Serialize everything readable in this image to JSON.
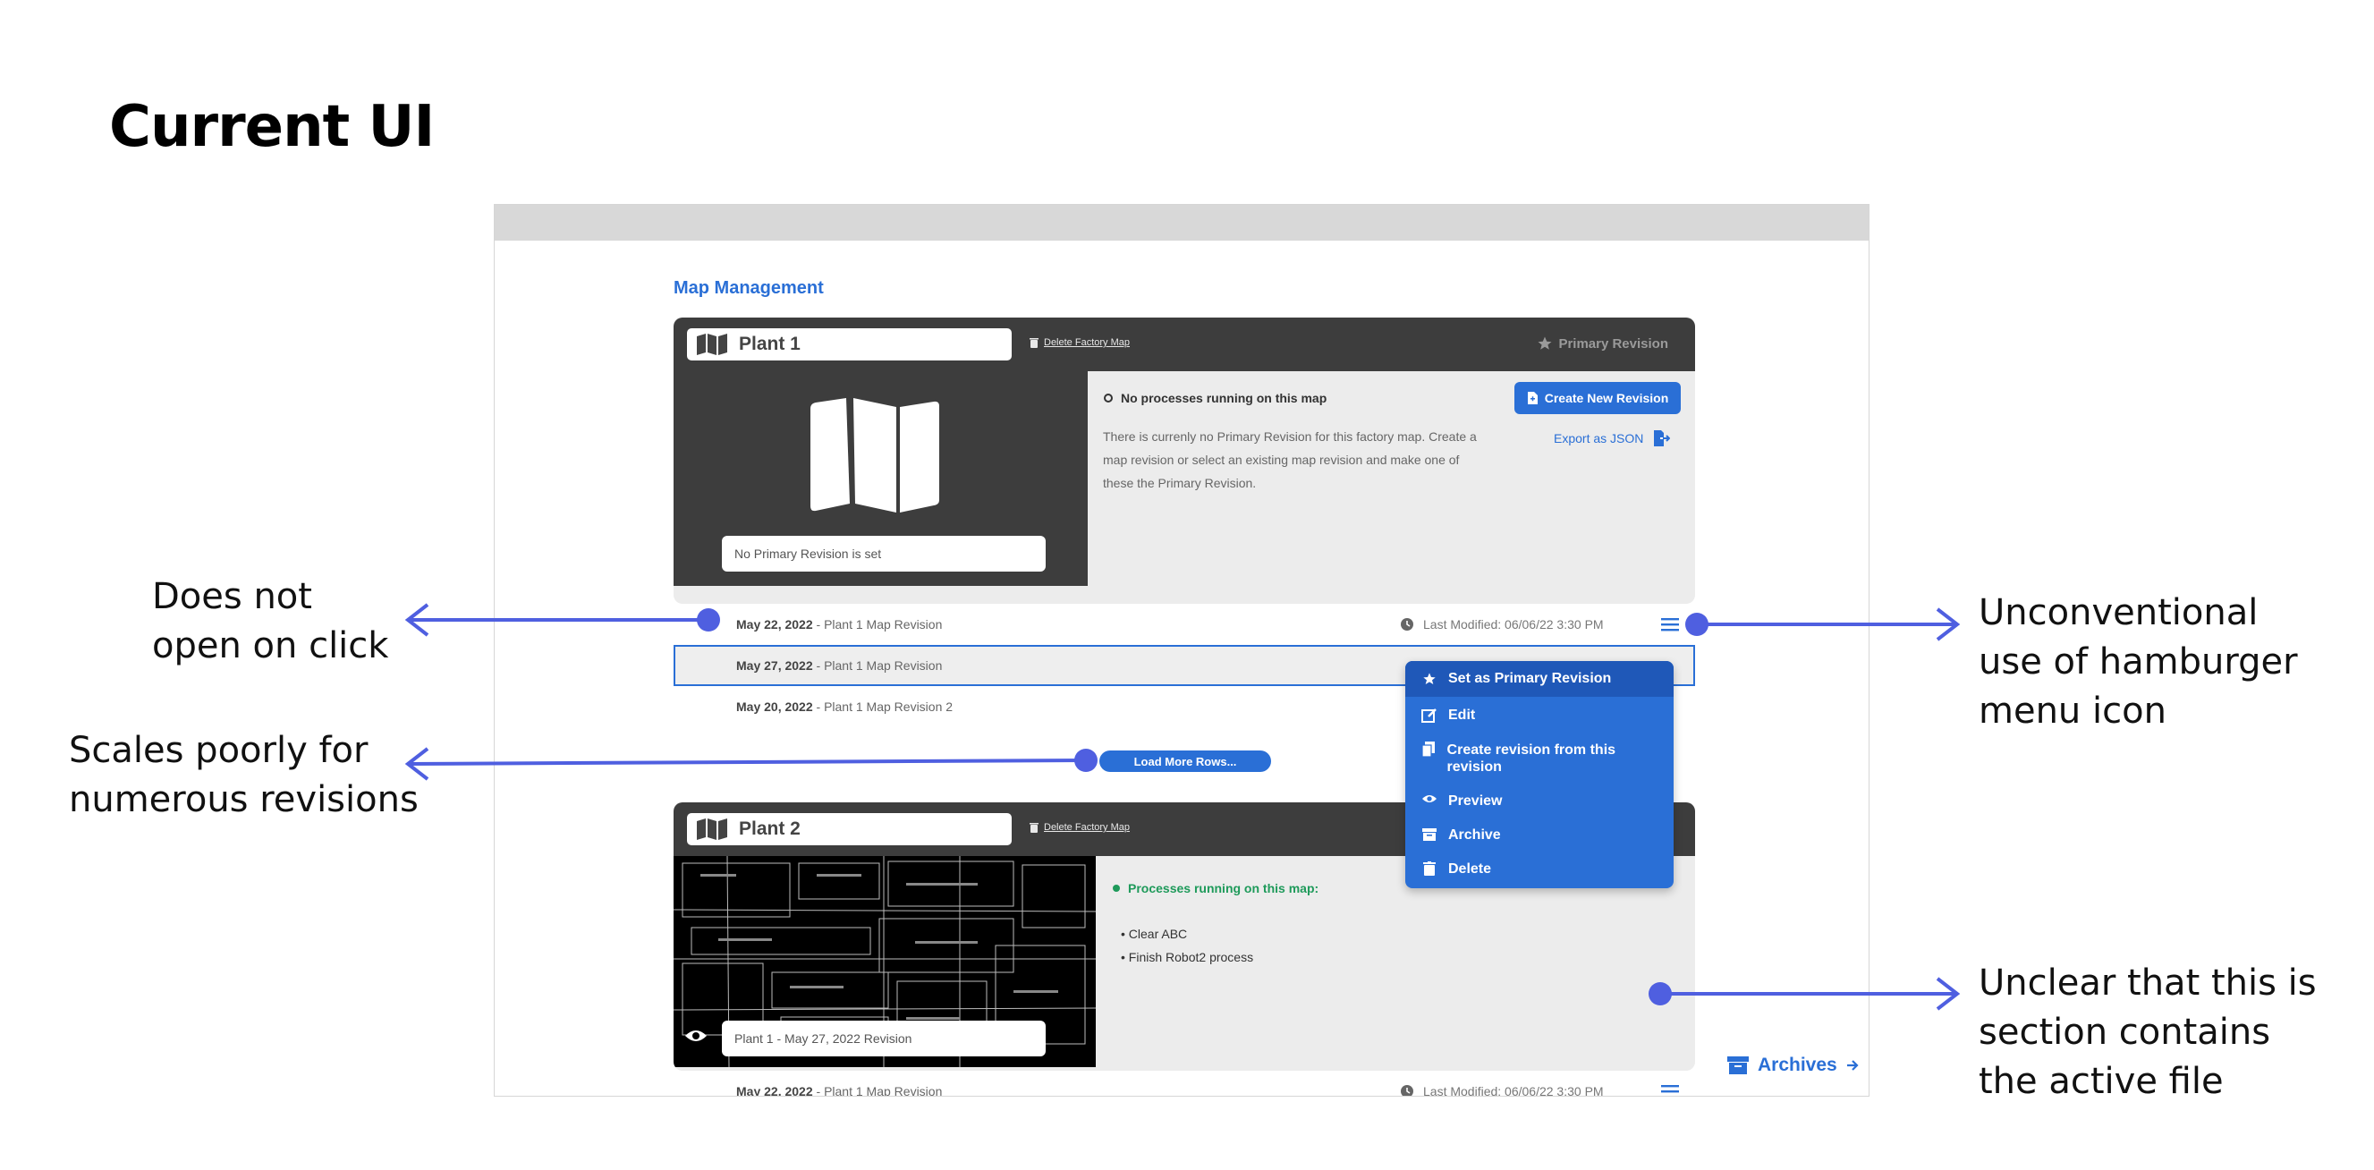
{
  "page": {
    "title": "Current UI"
  },
  "app": {
    "section_title": "Map Management",
    "plant1": {
      "name": "Plant 1",
      "delete_link": "Delete Factory Map",
      "primary_revision_label": "Primary Revision",
      "thumbnail_caption": "No Primary Revision is set",
      "status": "No processes running on this map",
      "description": "There is currenly no Primary Revision for this factory map. Create a map revision or select an existing map revision and make one of these the Primary Revision.",
      "create_button": "Create New Revision",
      "export_link": "Export as JSON"
    },
    "revisions": [
      {
        "date": "May 22, 2022",
        "name": " - Plant 1 Map Revision",
        "last_modified": "Last Modified: 06/06/22 3:30 PM"
      },
      {
        "date": "May 27, 2022",
        "name": " - Plant 1 Map Revision"
      },
      {
        "date": "May 20, 2022",
        "name": " - Plant 1 Map Revision 2"
      }
    ],
    "load_more": "Load More Rows...",
    "context_menu": {
      "items": [
        {
          "label": "Set as Primary Revision",
          "icon": "star-icon"
        },
        {
          "label": "Edit",
          "icon": "edit-icon"
        },
        {
          "label": "Create revision from this revision",
          "icon": "copy-icon"
        },
        {
          "label": "Preview",
          "icon": "eye-icon"
        },
        {
          "label": "Archive",
          "icon": "archive-icon"
        },
        {
          "label": "Delete",
          "icon": "trash-icon"
        }
      ]
    },
    "plant2": {
      "name": "Plant 2",
      "delete_link": "Delete Factory Map",
      "thumbnail_caption": "Plant 1 - May 27, 2022 Revision",
      "status": "Processes running on this map:",
      "processes": [
        "Clear ABC",
        "Finish Robot2 process"
      ],
      "revision": {
        "date": "May 22, 2022",
        "name": " - Plant 1 Map Revision",
        "last_modified": "Last Modified: 06/06/22 3:30 PM"
      }
    },
    "archives_link": "Archives"
  },
  "annotations": {
    "left1": [
      "Does not",
      "open on click"
    ],
    "left2": [
      "Scales poorly for",
      "numerous revisions"
    ],
    "right1": [
      "Unconventional",
      "use of hamburger",
      "menu icon"
    ],
    "right2": [
      "Unclear that this is",
      "section contains",
      "the active file"
    ]
  },
  "colors": {
    "accent": "#2a6fd6",
    "annotation": "#4f5fe0",
    "dark_header": "#3d3d3d",
    "active_green": "#1e9a5a"
  }
}
